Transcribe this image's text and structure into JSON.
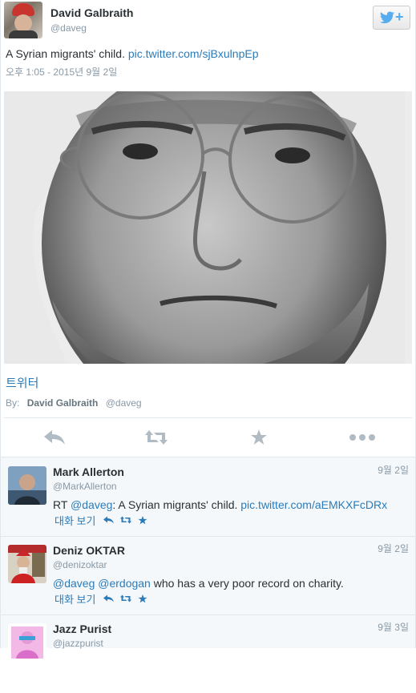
{
  "tweet": {
    "author_name": "David Galbraith",
    "author_handle": "@daveg",
    "text": "A Syrian migrants' child.",
    "link": "pic.twitter.com/sjBxulnpEp",
    "timestamp": "오후 1:05 - 2015년 9월 2일",
    "photo_source": "트위터",
    "byline_prefix": "By:",
    "byline_name": "David Galbraith",
    "byline_handle": "@daveg",
    "follow_icon": "twitter-bird-plus-icon"
  },
  "actions": [
    {
      "icon": "reply-icon"
    },
    {
      "icon": "retweet-icon"
    },
    {
      "icon": "favorite-star-icon"
    },
    {
      "icon": "more-dots-icon"
    }
  ],
  "colors": {
    "link": "#2b7bb9",
    "muted": "#8899a6",
    "action_icon": "#b1bbc3",
    "reply_bg": "#f5f8fa",
    "brand": "#55acee"
  },
  "replies": [
    {
      "name": "Mark Allerton",
      "handle": "@MarkAllerton",
      "date": "9월 2일",
      "prefix": "RT",
      "mention1": "@daveg",
      "text_mid": ": A Syrian migrants' child.",
      "link": "pic.twitter.com/aEMKXFcDRx",
      "conversation": "대화 보기"
    },
    {
      "name": "Deniz OKTAR",
      "handle": "@denizoktar",
      "date": "9월 2일",
      "mention1": "@daveg",
      "mention2": "@erdogan",
      "text_mid": "who has a very poor record on charity.",
      "conversation": "대화 보기"
    },
    {
      "name": "Jazz Purist",
      "handle": "@jazzpurist",
      "date": "9월 3일"
    }
  ]
}
